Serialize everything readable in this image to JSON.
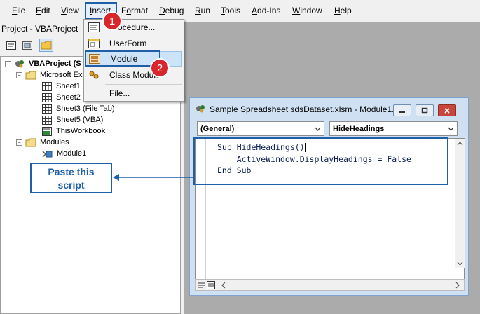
{
  "menubar": {
    "items": [
      "File",
      "Edit",
      "View",
      "Insert",
      "Format",
      "Debug",
      "Run",
      "Tools",
      "Add-Ins",
      "Window",
      "Help"
    ],
    "underline": [
      "F",
      "E",
      "V",
      "I",
      "o",
      "D",
      "R",
      "T",
      "A",
      "W",
      "H"
    ]
  },
  "project": {
    "title": "Project - VBAProject",
    "tree": {
      "root": "VBAProject (S",
      "objects_folder": "Microsoft Ex",
      "sheets": [
        "Sheet1 (",
        "Sheet2",
        "Sheet3 (File Tab)",
        "Sheet5 (VBA)",
        "ThisWorkbook"
      ],
      "modules_folder": "Modules",
      "module": "Module1"
    }
  },
  "insert_menu": {
    "items": [
      "Procedure...",
      "UserForm",
      "Module",
      "Class Module",
      "File..."
    ]
  },
  "badges": {
    "step1": "1",
    "step2": "2"
  },
  "code_window": {
    "title": "Sample Spreadsheet sdsDataset.xlsm - Module1...",
    "object_combo": "(General)",
    "procedure_combo": "HideHeadings",
    "code_lines": [
      "Sub HideHeadings()",
      "    ActiveWindow.DisplayHeadings = False",
      "End Sub"
    ]
  },
  "callout": {
    "line1": "Paste this",
    "line2": "script"
  },
  "colors": {
    "accent": "#1f5fa8",
    "badge": "#d9262c",
    "highlight": "#cde3f7"
  }
}
